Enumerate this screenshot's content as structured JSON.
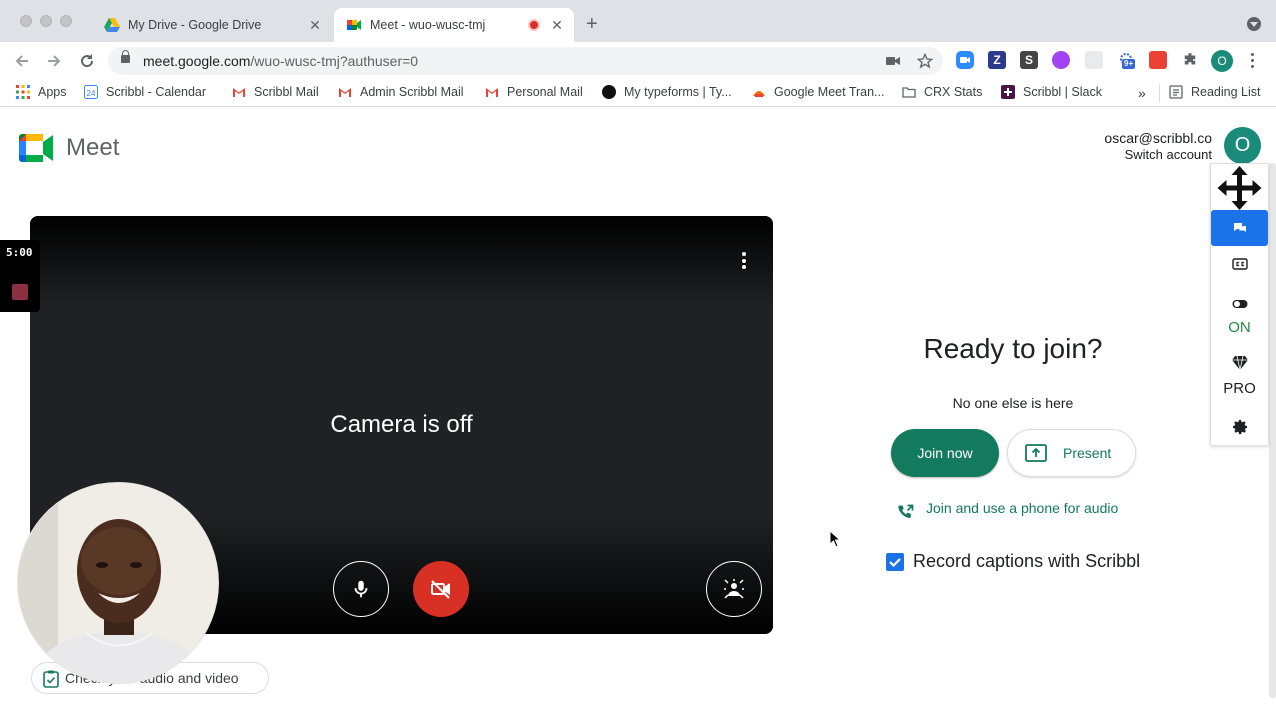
{
  "browser": {
    "tabs": [
      {
        "title": "My Drive - Google Drive",
        "close": "✕"
      },
      {
        "title": "Meet - wuo-wusc-tmj",
        "close": "✕"
      }
    ],
    "new_tab": "+",
    "url_host": "meet.google.com",
    "url_path": "/wuo-wusc-tmj?authuser=0",
    "profile_initial": "O",
    "extensions": [
      "Z",
      "S"
    ],
    "ext_badge": "9+"
  },
  "bookmarks": {
    "items": [
      "Apps",
      "Scribbl - Calendar",
      "Scribbl Mail",
      "Admin Scribbl Mail",
      "Personal Mail",
      "My typeforms | Ty...",
      "Google Meet Tran...",
      "CRX Stats",
      "Scribbl | Slack"
    ],
    "overflow": "»",
    "reading_list": "Reading List"
  },
  "meet": {
    "brand": "Meet",
    "account_email": "oscar@scribbl.co",
    "switch_account": "Switch account",
    "avatar_initial": "O",
    "preview_status": "Camera is off",
    "timer": "5:00",
    "check_av_label": "Check your audio and video",
    "ready_title": "Ready to join?",
    "no_one_text": "No one else is here",
    "join_now": "Join now",
    "present": "Present",
    "phone_audio": "Join and use a phone for audio",
    "record_captions": "Record captions with Scribbl"
  },
  "scribbl_panel": {
    "toggle_state": "ON",
    "plan": "PRO"
  },
  "colors": {
    "meet_green": "#137a5e",
    "cam_off_red": "#d93025",
    "scribbl_blue": "#1a73e8",
    "on_green": "#1e8e3e"
  }
}
